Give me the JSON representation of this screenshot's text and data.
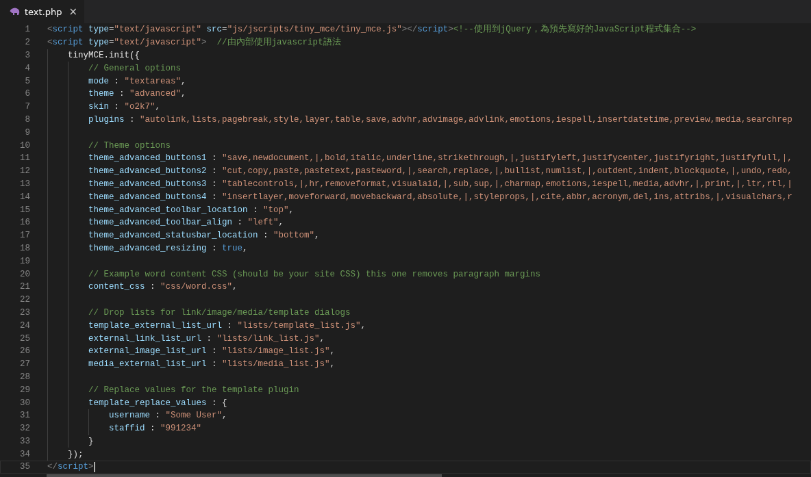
{
  "tabs": [
    {
      "label": "text.php",
      "close": "×",
      "selected": true
    }
  ],
  "editor": {
    "lines": [
      {
        "num": "1",
        "current": false,
        "tokens": [
          {
            "kind": "bracket",
            "text": "<"
          },
          {
            "kind": "tag",
            "text": "script"
          },
          {
            "kind": "attr",
            "text": " type"
          },
          {
            "kind": "punct",
            "text": "="
          },
          {
            "kind": "str",
            "text": "\"text/javascript\""
          },
          {
            "kind": "attr",
            "text": " src"
          },
          {
            "kind": "punct",
            "text": "="
          },
          {
            "kind": "str",
            "text": "\"js/jscripts/tiny_mce/tiny_mce.js\""
          },
          {
            "kind": "bracket",
            "text": "></"
          },
          {
            "kind": "tag",
            "text": "script"
          },
          {
            "kind": "bracket",
            "text": ">"
          },
          {
            "kind": "comment",
            "text": "<!--使用到jQuery，為預先寫好的JavaScript程式集合-->"
          }
        ]
      },
      {
        "num": "2",
        "current": false,
        "tokens": [
          {
            "kind": "bracket",
            "text": "<"
          },
          {
            "kind": "tag",
            "text": "script"
          },
          {
            "kind": "attr",
            "text": " type"
          },
          {
            "kind": "punct",
            "text": "="
          },
          {
            "kind": "str",
            "text": "\"text/javascript\""
          },
          {
            "kind": "bracket",
            "text": ">"
          },
          {
            "kind": "comment",
            "text": "  //由內部使用javascript語法"
          }
        ],
        "children": [
          {
            "num": "3",
            "current": false,
            "tokens": [
              {
                "kind": "plain",
                "text": "tinyMCE.init({"
              }
            ],
            "children": [
              {
                "num": "4",
                "current": false,
                "tokens": [
                  {
                    "kind": "comment",
                    "text": "// General options"
                  }
                ]
              },
              {
                "num": "5",
                "current": false,
                "tokens": [
                  {
                    "kind": "prop",
                    "text": "mode"
                  },
                  {
                    "kind": "punct",
                    "text": " : "
                  },
                  {
                    "kind": "str",
                    "text": "\"textareas\""
                  },
                  {
                    "kind": "punct",
                    "text": ","
                  }
                ]
              },
              {
                "num": "6",
                "current": false,
                "tokens": [
                  {
                    "kind": "prop",
                    "text": "theme"
                  },
                  {
                    "kind": "punct",
                    "text": " : "
                  },
                  {
                    "kind": "str",
                    "text": "\"advanced\""
                  },
                  {
                    "kind": "punct",
                    "text": ","
                  }
                ]
              },
              {
                "num": "7",
                "current": false,
                "tokens": [
                  {
                    "kind": "prop",
                    "text": "skin"
                  },
                  {
                    "kind": "punct",
                    "text": " : "
                  },
                  {
                    "kind": "str",
                    "text": "\"o2k7\""
                  },
                  {
                    "kind": "punct",
                    "text": ","
                  }
                ]
              },
              {
                "num": "8",
                "current": false,
                "tokens": [
                  {
                    "kind": "prop",
                    "text": "plugins"
                  },
                  {
                    "kind": "punct",
                    "text": " : "
                  },
                  {
                    "kind": "str",
                    "text": "\"autolink,lists,pagebreak,style,layer,table,save,advhr,advimage,advlink,emotions,iespell,insertdatetime,preview,media,searchrep"
                  }
                ]
              },
              {
                "num": "9",
                "current": false
              },
              {
                "num": "10",
                "current": false,
                "tokens": [
                  {
                    "kind": "comment",
                    "text": "// Theme options"
                  }
                ]
              },
              {
                "num": "11",
                "current": false,
                "tokens": [
                  {
                    "kind": "prop",
                    "text": "theme_advanced_buttons1"
                  },
                  {
                    "kind": "punct",
                    "text": " : "
                  },
                  {
                    "kind": "str",
                    "text": "\"save,newdocument,|,bold,italic,underline,strikethrough,|,justifyleft,justifycenter,justifyright,justifyfull,|,"
                  }
                ]
              },
              {
                "num": "12",
                "current": false,
                "tokens": [
                  {
                    "kind": "prop",
                    "text": "theme_advanced_buttons2"
                  },
                  {
                    "kind": "punct",
                    "text": " : "
                  },
                  {
                    "kind": "str",
                    "text": "\"cut,copy,paste,pastetext,pasteword,|,search,replace,|,bullist,numlist,|,outdent,indent,blockquote,|,undo,redo,"
                  }
                ]
              },
              {
                "num": "13",
                "current": false,
                "tokens": [
                  {
                    "kind": "prop",
                    "text": "theme_advanced_buttons3"
                  },
                  {
                    "kind": "punct",
                    "text": " : "
                  },
                  {
                    "kind": "str",
                    "text": "\"tablecontrols,|,hr,removeformat,visualaid,|,sub,sup,|,charmap,emotions,iespell,media,advhr,|,print,|,ltr,rtl,|"
                  }
                ]
              },
              {
                "num": "14",
                "current": false,
                "tokens": [
                  {
                    "kind": "prop",
                    "text": "theme_advanced_buttons4"
                  },
                  {
                    "kind": "punct",
                    "text": " : "
                  },
                  {
                    "kind": "str",
                    "text": "\"insertlayer,moveforward,movebackward,absolute,|,styleprops,|,cite,abbr,acronym,del,ins,attribs,|,visualchars,r"
                  }
                ]
              },
              {
                "num": "15",
                "current": false,
                "tokens": [
                  {
                    "kind": "prop",
                    "text": "theme_advanced_toolbar_location"
                  },
                  {
                    "kind": "punct",
                    "text": " : "
                  },
                  {
                    "kind": "str",
                    "text": "\"top\""
                  },
                  {
                    "kind": "punct",
                    "text": ","
                  }
                ]
              },
              {
                "num": "16",
                "current": false,
                "tokens": [
                  {
                    "kind": "prop",
                    "text": "theme_advanced_toolbar_align"
                  },
                  {
                    "kind": "punct",
                    "text": " : "
                  },
                  {
                    "kind": "str",
                    "text": "\"left\""
                  },
                  {
                    "kind": "punct",
                    "text": ","
                  }
                ]
              },
              {
                "num": "17",
                "current": false,
                "tokens": [
                  {
                    "kind": "prop",
                    "text": "theme_advanced_statusbar_location"
                  },
                  {
                    "kind": "punct",
                    "text": " : "
                  },
                  {
                    "kind": "str",
                    "text": "\"bottom\""
                  },
                  {
                    "kind": "punct",
                    "text": ","
                  }
                ]
              },
              {
                "num": "18",
                "current": false,
                "tokens": [
                  {
                    "kind": "prop",
                    "text": "theme_advanced_resizing"
                  },
                  {
                    "kind": "punct",
                    "text": " : "
                  },
                  {
                    "kind": "keyword",
                    "text": "true"
                  },
                  {
                    "kind": "punct",
                    "text": ","
                  }
                ]
              },
              {
                "num": "19",
                "current": false
              },
              {
                "num": "20",
                "current": false,
                "tokens": [
                  {
                    "kind": "comment",
                    "text": "// Example word content CSS (should be your site CSS) this one removes paragraph margins"
                  }
                ]
              },
              {
                "num": "21",
                "current": false,
                "tokens": [
                  {
                    "kind": "prop",
                    "text": "content_css"
                  },
                  {
                    "kind": "punct",
                    "text": " : "
                  },
                  {
                    "kind": "str",
                    "text": "\"css/word.css\""
                  },
                  {
                    "kind": "punct",
                    "text": ","
                  }
                ]
              },
              {
                "num": "22",
                "current": false
              },
              {
                "num": "23",
                "current": false,
                "tokens": [
                  {
                    "kind": "comment",
                    "text": "// Drop lists for link/image/media/template dialogs"
                  }
                ]
              },
              {
                "num": "24",
                "current": false,
                "tokens": [
                  {
                    "kind": "prop",
                    "text": "template_external_list_url"
                  },
                  {
                    "kind": "punct",
                    "text": " : "
                  },
                  {
                    "kind": "str",
                    "text": "\"lists/template_list.js\""
                  },
                  {
                    "kind": "punct",
                    "text": ","
                  }
                ]
              },
              {
                "num": "25",
                "current": false,
                "tokens": [
                  {
                    "kind": "prop",
                    "text": "external_link_list_url"
                  },
                  {
                    "kind": "punct",
                    "text": " : "
                  },
                  {
                    "kind": "str",
                    "text": "\"lists/link_list.js\""
                  },
                  {
                    "kind": "punct",
                    "text": ","
                  }
                ]
              },
              {
                "num": "26",
                "current": false,
                "tokens": [
                  {
                    "kind": "prop",
                    "text": "external_image_list_url"
                  },
                  {
                    "kind": "punct",
                    "text": " : "
                  },
                  {
                    "kind": "str",
                    "text": "\"lists/image_list.js\""
                  },
                  {
                    "kind": "punct",
                    "text": ","
                  }
                ]
              },
              {
                "num": "27",
                "current": false,
                "tokens": [
                  {
                    "kind": "prop",
                    "text": "media_external_list_url"
                  },
                  {
                    "kind": "punct",
                    "text": " : "
                  },
                  {
                    "kind": "str",
                    "text": "\"lists/media_list.js\""
                  },
                  {
                    "kind": "punct",
                    "text": ","
                  }
                ]
              },
              {
                "num": "28",
                "current": false
              },
              {
                "num": "29",
                "current": false,
                "tokens": [
                  {
                    "kind": "comment",
                    "text": "// Replace values for the template plugin"
                  }
                ]
              },
              {
                "num": "30",
                "current": false,
                "tokens": [
                  {
                    "kind": "prop",
                    "text": "template_replace_values"
                  },
                  {
                    "kind": "punct",
                    "text": " : {"
                  }
                ],
                "children": [
                  {
                    "num": "31",
                    "current": false,
                    "tokens": [
                      {
                        "kind": "prop",
                        "text": "username"
                      },
                      {
                        "kind": "punct",
                        "text": " : "
                      },
                      {
                        "kind": "str",
                        "text": "\"Some User\""
                      },
                      {
                        "kind": "punct",
                        "text": ","
                      }
                    ]
                  },
                  {
                    "num": "32",
                    "current": false,
                    "tokens": [
                      {
                        "kind": "prop",
                        "text": "staffid"
                      },
                      {
                        "kind": "punct",
                        "text": " : "
                      },
                      {
                        "kind": "str",
                        "text": "\"991234\""
                      }
                    ]
                  }
                ]
              },
              {
                "num": "33",
                "current": false,
                "tokens": [
                  {
                    "kind": "punct",
                    "text": "}"
                  }
                ]
              }
            ]
          },
          {
            "num": "34",
            "current": false,
            "tokens": [
              {
                "kind": "punct",
                "text": "});"
              }
            ]
          }
        ]
      },
      {
        "num": "35",
        "current": true,
        "tokens": [
          {
            "kind": "bracket",
            "text": "</"
          },
          {
            "kind": "tag",
            "text": "script"
          },
          {
            "kind": "bracket",
            "text": ">"
          }
        ]
      }
    ]
  }
}
